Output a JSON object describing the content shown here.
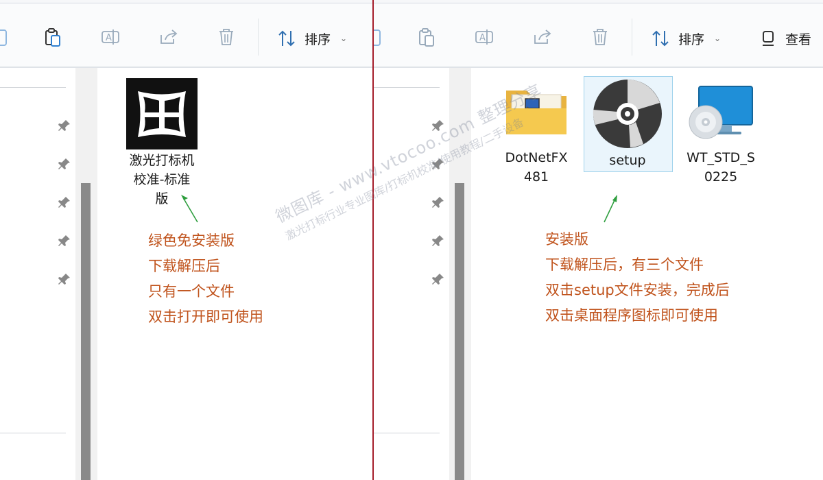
{
  "left_window": {
    "toolbar": {
      "sort_label": "排序"
    },
    "file": {
      "name_line1": "激光打标机",
      "name_line2": "校准-标准",
      "name_line3": "版"
    },
    "annotation": [
      "绿色免安装版",
      "下载解压后",
      "只有一个文件",
      "双击打开即可使用"
    ]
  },
  "right_window": {
    "toolbar": {
      "sort_label": "排序",
      "view_label": "查看"
    },
    "files": [
      {
        "line1": "DotNetFX",
        "line2": "481",
        "icon": "folder-icon"
      },
      {
        "line1": "setup",
        "line2": "",
        "icon": "disc-icon"
      },
      {
        "line1": "WT_STD_S",
        "line2": "0225",
        "icon": "monitor-disc-icon"
      }
    ],
    "annotation": [
      "安装版",
      "下载解压后，有三个文件",
      "双击setup文件安装，完成后",
      "双击桌面程序图标即可使用"
    ]
  },
  "watermark": {
    "line1": "微图库 - www.vtocoo.com 整理分享",
    "line2": "激光打标行业专业图库/打标机校准/使用教程/二手设备"
  },
  "colors": {
    "annotation": "#c0531c",
    "arrow": "#2e9e3e",
    "divider": "#a51d2a",
    "scrollbar": "#8a8a8a"
  }
}
